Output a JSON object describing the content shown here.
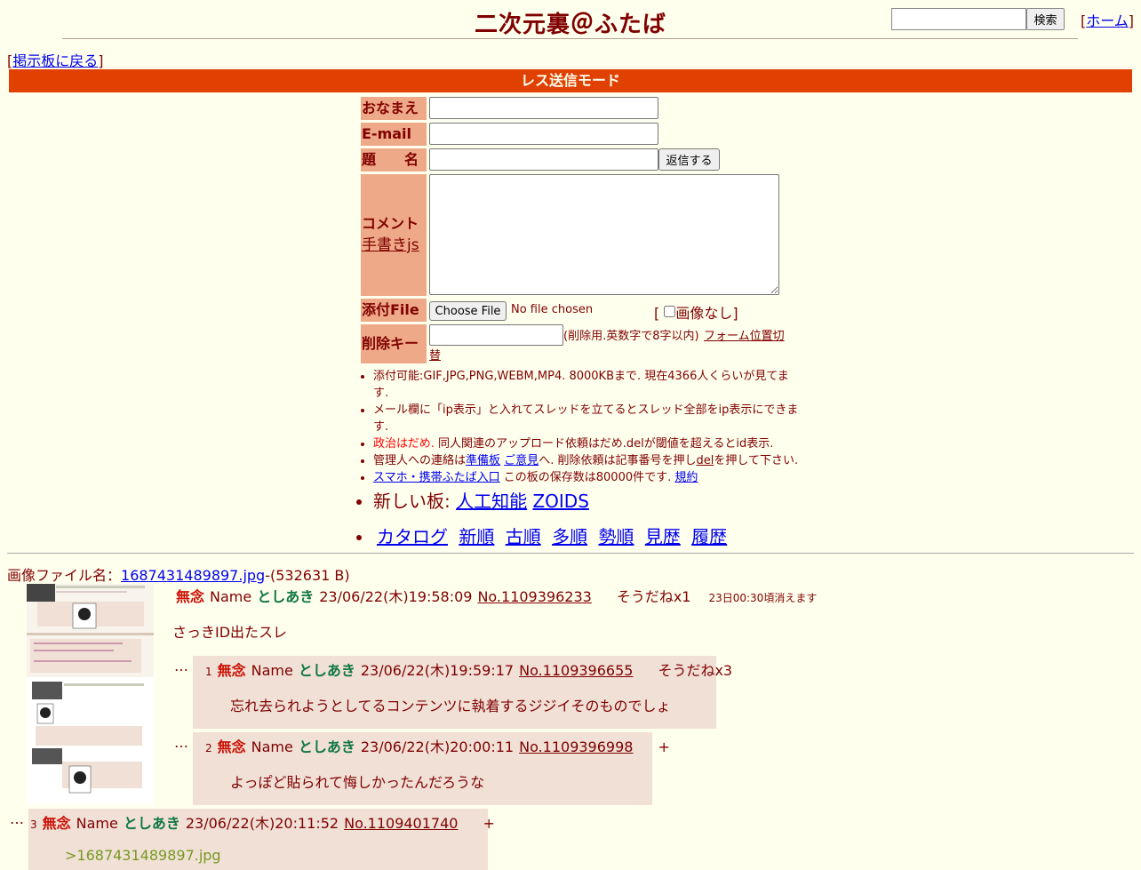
{
  "header": {
    "title": "二次元裏＠ふたば",
    "search_button": "検索",
    "home_link": "ホーム",
    "back_link": "掲示板に戻る"
  },
  "mode_bar": "レス送信モード",
  "form": {
    "name_label": "おなまえ",
    "email_label": "E-mail",
    "subject_label": "題　　名",
    "submit_button": "返信する",
    "comment_label": "コメント",
    "tegaki_link": "手書きjs",
    "file_label": "添付File",
    "choose_file_button": "Choose File",
    "no_file_text": "No file chosen",
    "no_image_label": "画像なし",
    "delkey_label": "削除キー",
    "delkey_note": "(削除用.英数字で8字以内)",
    "form_toggle_link": "フォーム位置切替"
  },
  "notes": {
    "n1": "添付可能:GIF,JPG,PNG,WEBM,MP4. 8000KBまで. 現在4366人くらいが見てます.",
    "n2": "メール欄に「ip表示」と入れてスレッドを立てるとスレッド全部をip表示にできます.",
    "n3_red": "政治はだめ.",
    "n3_rest": " 同人関連のアップロード依頼はだめ.delが閾値を超えるとid表示.",
    "n4_a": "管理人への連絡は",
    "n4_link1": "準備板",
    "n4_link2": "ご意見",
    "n4_b": "へ. 削除依頼は記事番号を押し",
    "n4_link3": "del",
    "n4_c": "を押して下さい.",
    "n5_link1": "スマホ・携帯ふたば入口",
    "n5_text": " この板の保存数は80000件です.",
    "n5_link2": "規約",
    "new_boards_label": "新しい板: ",
    "new_board_1": "人工知能",
    "new_board_2": "ZOIDS",
    "sort_links": [
      "カタログ",
      "新順",
      "古順",
      "多順",
      "勢順",
      "見歴",
      "履歴"
    ]
  },
  "thread": {
    "file_label": "画像ファイル名：",
    "file_name": "1687431489897.jpg",
    "file_size": "-(532631 B)",
    "op": {
      "subject": "無念",
      "name_label": "Name",
      "name": "としあき",
      "date": "23/06/22(木)19:58:09",
      "no": "No.1109396233",
      "sod": "そうだねx1",
      "expire": "23日00:30頃消えます",
      "body": "さっきID出たスレ"
    },
    "replies": [
      {
        "num": "1",
        "subject": "無念",
        "name_label": "Name",
        "name": "としあき",
        "date": "23/06/22(木)19:59:17",
        "no": "No.1109396655",
        "sod": "そうだねx3",
        "body": "忘れ去られようとしてるコンテンツに執着するジジイそのものでしょ"
      },
      {
        "num": "2",
        "subject": "無念",
        "name_label": "Name",
        "name": "としあき",
        "date": "23/06/22(木)20:00:11",
        "no": "No.1109396998",
        "sod": "+",
        "body": "よっぽど貼られて悔しかったんだろうな"
      },
      {
        "num": "3",
        "subject": "無念",
        "name_label": "Name",
        "name": "としあき",
        "date": "23/06/22(木)20:11:52",
        "no": "No.1109401740",
        "sod": "+",
        "body": ">1687431489897.jpg"
      }
    ],
    "dots": "…"
  }
}
